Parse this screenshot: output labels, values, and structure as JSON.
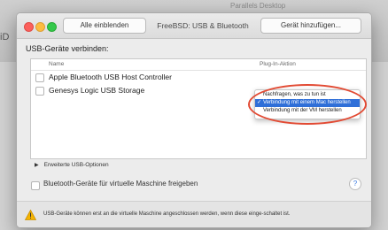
{
  "background": {
    "left_text": "iD",
    "faint_text": "Parallels Desktop"
  },
  "window": {
    "title": "FreeBSD: USB & Bluetooth",
    "buttons": {
      "show_all": "Alle einblenden",
      "add_device": "Gerät hinzufügen..."
    }
  },
  "usb": {
    "section_title": "USB-Geräte verbinden:",
    "columns": {
      "name": "Name",
      "action": "Plug-In-Aktion"
    },
    "devices": [
      {
        "name": "Apple Bluetooth USB Host Controller",
        "checked": false
      },
      {
        "name": "Genesys Logic USB Storage",
        "checked": false
      }
    ],
    "action_menu": {
      "items": [
        "Nachfragen, was zu tun ist",
        "Verbindung mit einem Mac herstellen",
        "Verbindung mit der VM herstellen"
      ],
      "selected_index": 1,
      "check_glyph": "✓"
    }
  },
  "advanced": {
    "label": "Erweiterte USB-Optionen",
    "disclosure_glyph": "▶"
  },
  "bluetooth": {
    "share_label": "Bluetooth-Geräte für virtuelle Maschine freigeben",
    "checked": false
  },
  "help": {
    "glyph": "?"
  },
  "footer": {
    "message": "USB-Geräte können erst an die virtuelle Maschine angeschlossen werden, wenn diese einge-schaltet ist."
  },
  "colors": {
    "selection": "#2f6fd8",
    "highlight_ring": "#e24a33",
    "warning": "#f5b400",
    "close": "#fc605c",
    "minimize": "#fdbc40",
    "zoom": "#34c84a"
  },
  "icons": {
    "traffic_lights": [
      "close-icon",
      "minimize-icon",
      "zoom-icon"
    ],
    "footer_warning": "warning-icon"
  }
}
